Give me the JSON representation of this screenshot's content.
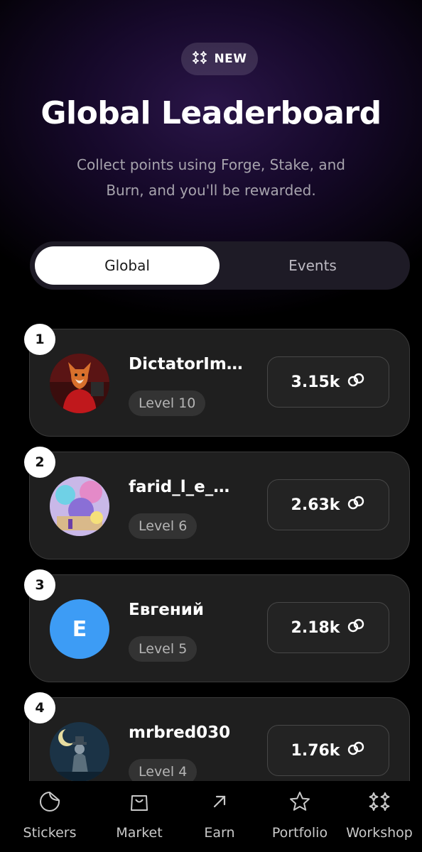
{
  "badge": {
    "label": "NEW",
    "icon": "sparkles-icon"
  },
  "header": {
    "title": "Global Leaderboard",
    "subtitle_line1": "Collect points using Forge, Stake, and",
    "subtitle_line2": "Burn, and you'll be rewarded."
  },
  "tabs": [
    {
      "label": "Global",
      "active": true
    },
    {
      "label": "Events",
      "active": false
    }
  ],
  "leaderboard": [
    {
      "rank": "1",
      "name": "DictatorIm…",
      "level": "Level 10",
      "points": "3.15k",
      "avatar": "fox-avatar"
    },
    {
      "rank": "2",
      "name": "farid_l_e_…",
      "level": "Level 6",
      "points": "2.63k",
      "avatar": "colorful-art-avatar"
    },
    {
      "rank": "3",
      "name": "Евгений",
      "level": "Level 5",
      "points": "2.18k",
      "avatar_letter": "E"
    },
    {
      "rank": "4",
      "name": "mrbred030",
      "level": "Level 4",
      "points": "1.76k",
      "avatar": "night-figure-avatar"
    }
  ],
  "nav": [
    {
      "label": "Stickers",
      "icon": "sticker-icon"
    },
    {
      "label": "Market",
      "icon": "shopping-bag-icon"
    },
    {
      "label": "Earn",
      "icon": "arrow-up-right-icon"
    },
    {
      "label": "Portfolio",
      "icon": "star-icon"
    },
    {
      "label": "Workshop",
      "icon": "sparkles-icon"
    }
  ],
  "colors": {
    "background": "#000000",
    "card": "#1f1f1f",
    "accent_avatar": "#3d9cf5",
    "glow": "#2a1548"
  }
}
